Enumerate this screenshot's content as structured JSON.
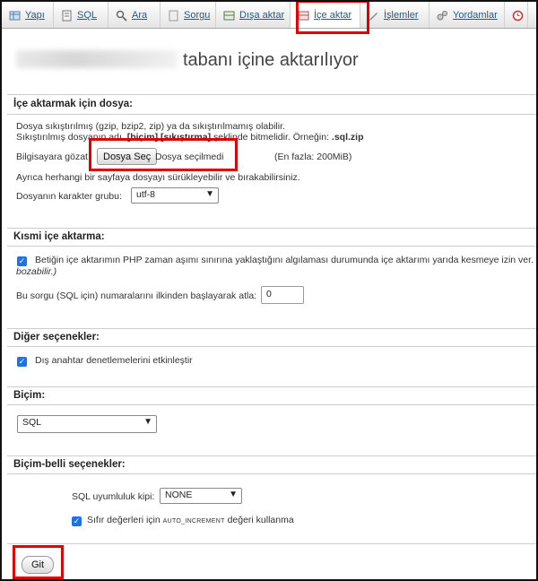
{
  "tabs": [
    {
      "label": "Yapı",
      "icon": "structure-icon"
    },
    {
      "label": "SQL",
      "icon": "sql-icon"
    },
    {
      "label": "Ara",
      "icon": "search-icon"
    },
    {
      "label": "Sorgu",
      "icon": "query-icon"
    },
    {
      "label": "Dışa aktar",
      "icon": "export-icon"
    },
    {
      "label": "İçe aktar",
      "icon": "import-icon"
    },
    {
      "label": "İşlemler",
      "icon": "operations-icon"
    },
    {
      "label": "Yordamlar",
      "icon": "routines-icon"
    }
  ],
  "title": "tabanı içine aktarılıyor",
  "file_section": {
    "heading": "İçe aktarmak için dosya:",
    "line1": "Dosya sıkıştırılmış (gzip, bzip2, zip) ya da sıkıştırılmamış olabilir.",
    "line2_a": "Sıkıştırılmış dosyanın adı ",
    "line2_b": ".[biçim].[sıkıştırma]",
    "line2_c": " şeklinde bitmelidir. Örneğin: ",
    "line2_d": ".sql.zip",
    "browse_label": "Bilgisayara gözat:",
    "choose_file": "Dosya Seç",
    "no_file": "Dosya seçilmedi",
    "max_size": "(En fazla: 200MiB)",
    "drag_hint": "Ayrıca herhangi bir sayfaya dosyayı sürükleyebilir ve bırakabilirsiniz.",
    "charset_label": "Dosyanın karakter grubu:",
    "charset_value": "utf-8"
  },
  "partial_section": {
    "heading": "Kısmi içe aktarma:",
    "interrupt_text": "Betiğin içe aktarımın PHP zaman aşımı sınırına yaklaştığını algılaması durumunda içe aktarımı yarıda kesmeye izin ver.",
    "interrupt_tail": "(",
    "interrupt_line2": "bozabilir.)",
    "skip_label": "Bu sorgu (SQL için) numaralarını ilkinden başlayarak atla:",
    "skip_value": "0"
  },
  "other_section": {
    "heading": "Diğer seçenekler:",
    "fk_label": "Dış anahtar denetlemelerini etkinleştir"
  },
  "format_section": {
    "heading": "Biçim:",
    "format_value": "SQL"
  },
  "format_specific": {
    "heading": "Biçim-belli seçenekler:",
    "compat_label": "SQL uyumluluk kipi:",
    "compat_value": "NONE",
    "zero_a": "Sıfır değerleri için ",
    "zero_b": "AUTO_INCREMENT",
    "zero_c": " değeri kullanma"
  },
  "go_button": "Git",
  "colors": {
    "link": "#235a81",
    "highlight": "#e00000",
    "checkbox": "#1a73e8"
  }
}
